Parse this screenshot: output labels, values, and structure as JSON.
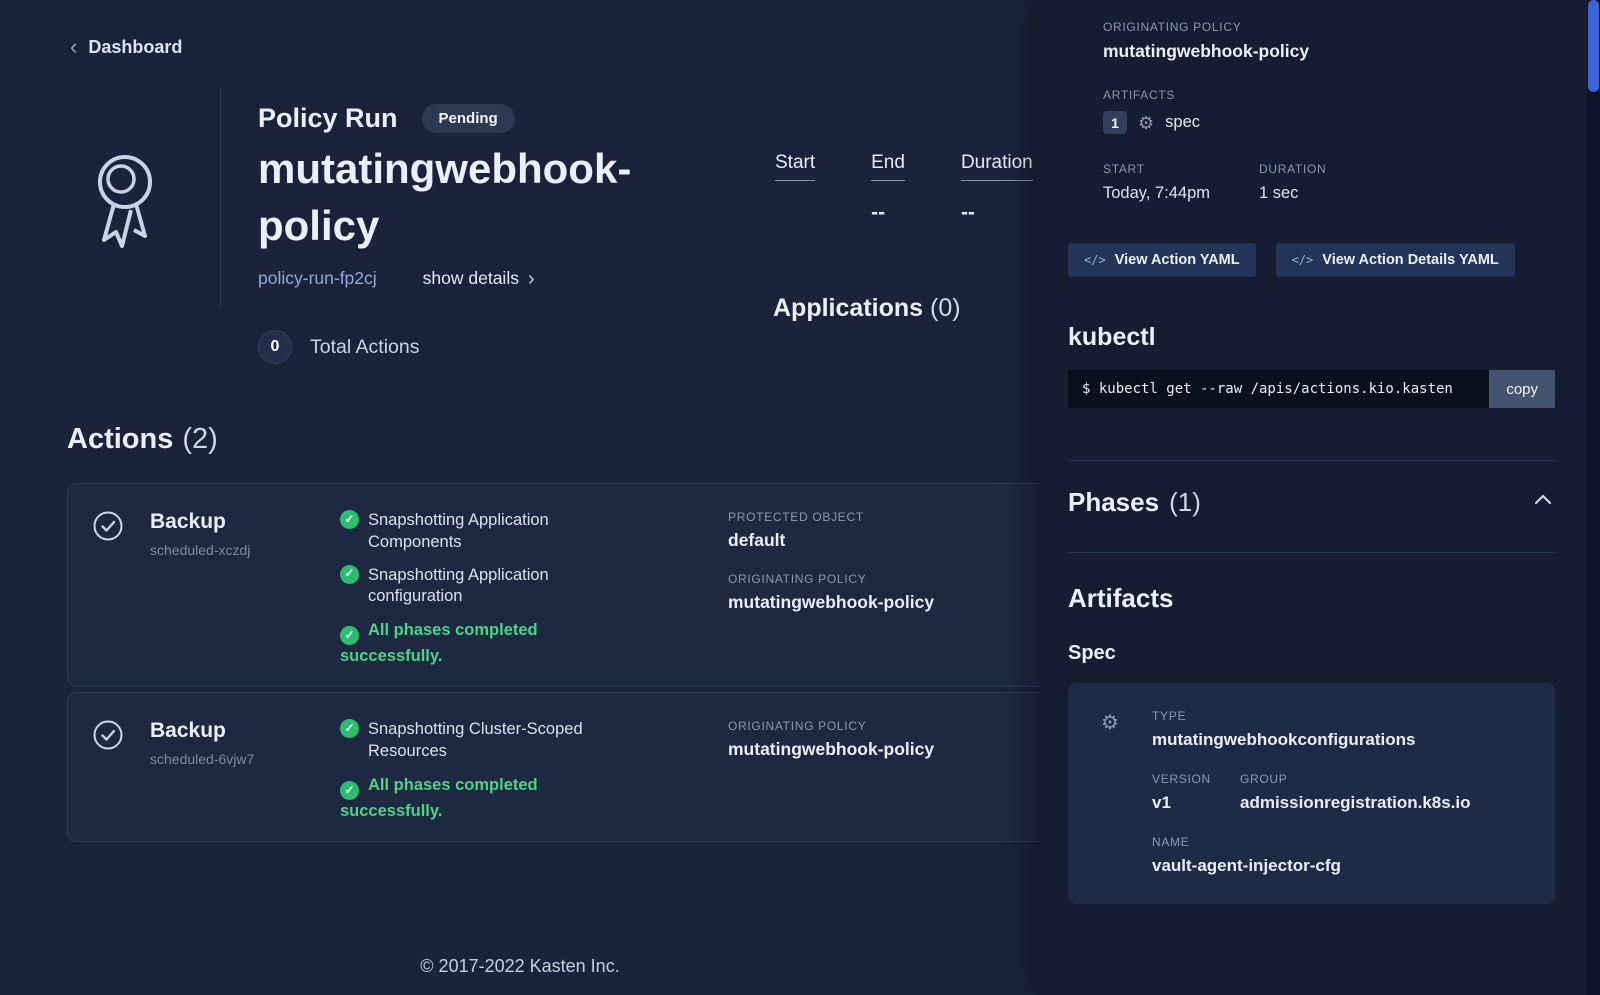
{
  "colors": {
    "background": "#19243a",
    "panel_background": "#141e30",
    "card_background": "#1d2940",
    "accent_green": "#2dbd71",
    "green_text": "#4fd288",
    "link_blue": "#8fa9db",
    "label_gray": "#8b98b0",
    "button_blue": "#243457",
    "scroll_thumb_blue": "#3c63d8"
  },
  "breadcrumb": {
    "label": "Dashboard"
  },
  "policy_run": {
    "title": "Policy Run",
    "status": "Pending",
    "name": "mutatingwebhook-policy",
    "run_id": "policy-run-fp2cj",
    "show_details": "show details",
    "stats": [
      {
        "label": "Start",
        "value": ""
      },
      {
        "label": "End",
        "value": "--"
      },
      {
        "label": "Duration",
        "value": "--"
      }
    ],
    "applications_label": "Applications",
    "applications_count": "(0)",
    "total_actions_count": "0",
    "total_actions_label": "Total Actions"
  },
  "actions": {
    "title": "Actions",
    "count": "(2)",
    "items": [
      {
        "type": "Backup",
        "id": "scheduled-xczdj",
        "phases": [
          "Snapshotting Application Components",
          "Snapshotting Application configuration"
        ],
        "completion": "All phases completed successfully.",
        "fields": [
          {
            "label": "PROTECTED OBJECT",
            "value": "default"
          },
          {
            "label": "ORIGINATING POLICY",
            "value": "mutatingwebhook-policy"
          }
        ]
      },
      {
        "type": "Backup",
        "id": "scheduled-6vjw7",
        "phases": [
          "Snapshotting Cluster-Scoped Resources"
        ],
        "completion": "All phases completed successfully.",
        "fields": [
          {
            "label": "ORIGINATING POLICY",
            "value": "mutatingwebhook-policy"
          }
        ]
      }
    ]
  },
  "footer": "© 2017-2022 Kasten Inc.",
  "panel": {
    "originating_policy_label": "ORIGINATING POLICY",
    "originating_policy_value": "mutatingwebhook-policy",
    "artifacts_label": "ARTIFACTS",
    "artifacts_count": "1",
    "artifacts_kind": "spec",
    "start_label": "START",
    "start_value": "Today, 7:44pm",
    "duration_label": "DURATION",
    "duration_value": "1 sec",
    "buttons": [
      {
        "label": "View Action YAML"
      },
      {
        "label": "View Action Details YAML"
      }
    ],
    "kubectl_title": "kubectl",
    "kubectl_command": "$ kubectl get --raw /apis/actions.kio.kasten",
    "copy_label": "copy",
    "phases_title": "Phases",
    "phases_count": "(1)",
    "artifacts_title": "Artifacts",
    "spec_title": "Spec",
    "spec": {
      "type_label": "TYPE",
      "type_value": "mutatingwebhookconfigurations",
      "version_label": "VERSION",
      "version_value": "v1",
      "group_label": "GROUP",
      "group_value": "admissionregistration.k8s.io",
      "name_label": "NAME",
      "name_value": "vault-agent-injector-cfg"
    }
  }
}
